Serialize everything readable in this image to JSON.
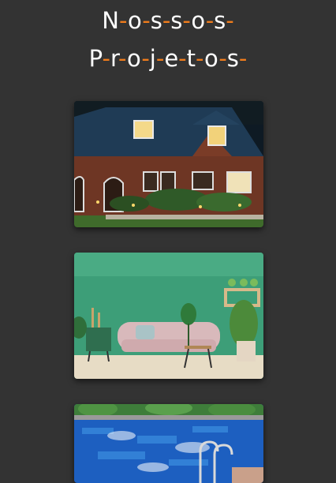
{
  "title": {
    "line1": [
      "N",
      "o",
      "s",
      "s",
      "o",
      "s"
    ],
    "line2": [
      "P",
      "r",
      "o",
      "j",
      "e",
      "t",
      "o",
      "s"
    ]
  },
  "colors": {
    "background": "#333333",
    "accent": "#f07c1c",
    "text": "#ffffff"
  },
  "projects": [
    {
      "name": "house-photo"
    },
    {
      "name": "living-room-photo"
    },
    {
      "name": "pool-photo"
    }
  ]
}
